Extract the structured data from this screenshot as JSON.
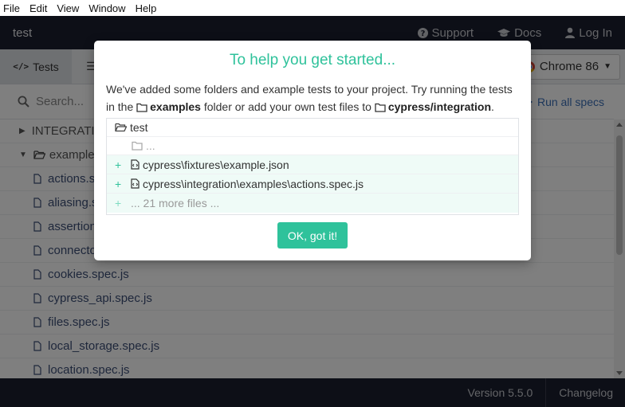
{
  "menu": [
    "File",
    "Edit",
    "View",
    "Window",
    "Help"
  ],
  "header": {
    "project": "test",
    "support": "Support",
    "docs": "Docs",
    "login": "Log In"
  },
  "tabs": {
    "tests": "Tests",
    "browser": "Chrome 86"
  },
  "search": {
    "placeholder": "Search...",
    "run_all": "Run all specs"
  },
  "specs": {
    "group": "INTEGRATI",
    "folder": "example",
    "files": [
      "actions.s",
      "aliasing.s",
      "assertion",
      "connecto",
      "cookies.spec.js",
      "cypress_api.spec.js",
      "files.spec.js",
      "local_storage.spec.js",
      "location.spec.js"
    ]
  },
  "footer": {
    "version": "Version 5.5.0",
    "changelog": "Changelog"
  },
  "modal": {
    "title": "To help you get started...",
    "text_1": "We've added some folders and example tests to your project. Try running the tests in the",
    "examples": "examples",
    "text_2": "folder or add your own test files to",
    "integration": "cypress/integration",
    "text_3": ".",
    "tree": {
      "root": "test",
      "ellipsis": "...",
      "files": [
        "cypress\\fixtures\\example.json",
        "cypress\\integration\\examples\\actions.spec.js"
      ],
      "more": "... 21 more files ..."
    },
    "ok": "OK, got it!"
  },
  "colors": {
    "accent": "#2fc29b",
    "dark": "#1b1e2e",
    "link": "#3b6fb6"
  }
}
